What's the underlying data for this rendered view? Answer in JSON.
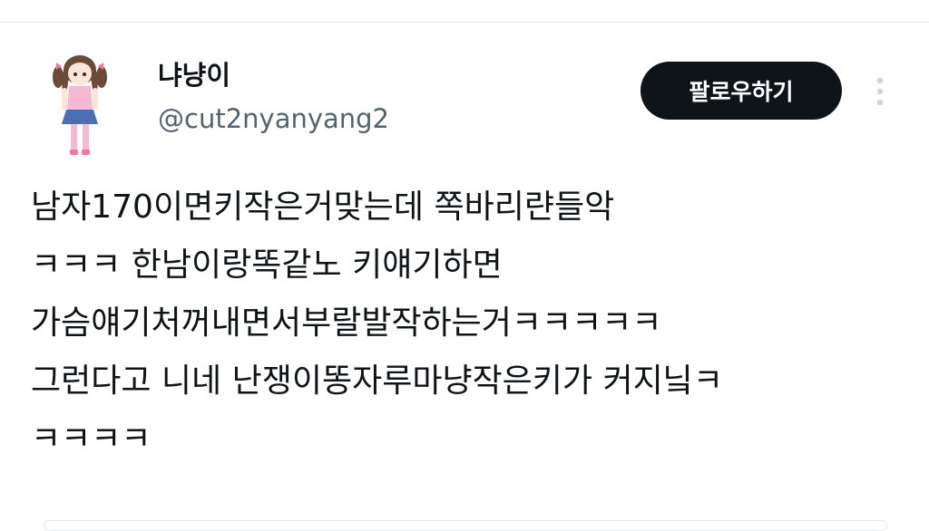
{
  "tweet": {
    "author": {
      "display_name": "냐냥이",
      "handle": "@cut2nyanyang2",
      "avatar_icon": "anime-girl-avatar-icon"
    },
    "follow_label": "팔로우하기",
    "more_icon": "more-vertical-icon",
    "text_lines": [
      "남자170이면키작은거맞는데 쪽바리랸들악",
      "ㅋㅋㅋ 한남이랑똑같노 키얘기하면",
      "가슴얘기처꺼내면서부랄발작하는거ㅋㅋㅋㅋㅋ",
      "그런다고 니네 난쟁이똥자루마냥작은키가 커지닠ㅋ",
      "ㅋㅋㅋㅋ"
    ]
  },
  "colors": {
    "text_primary": "#0f1419",
    "text_secondary": "#536471",
    "button_bg": "#0f1419",
    "button_text": "#ffffff",
    "divider": "#e6e9eb",
    "avatar_pink": "#f7b9d2",
    "avatar_hair": "#6b4a3a",
    "avatar_skirt": "#4a6fb5"
  }
}
